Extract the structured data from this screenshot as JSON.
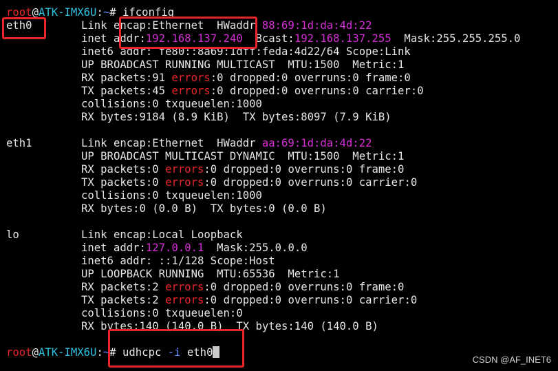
{
  "colors": {
    "background": "#000000",
    "text": "#e6e6e6",
    "user": "#e8262a",
    "host": "#2ec0e0",
    "path": "#5b8cff",
    "address": "#d62ed6",
    "errors": "#e8262a",
    "highlight_box": "#e8262a"
  },
  "prompt": {
    "user": "root",
    "at": "@",
    "host": "ATK-IMX6U",
    "sep": ":",
    "path": "~",
    "sym": "#"
  },
  "cmd1": " ifconfig",
  "eth0": {
    "name": "eth0",
    "l1": {
      "a": "Link encap:Ethernet  HWaddr ",
      "hw": "88:69:1d:da:4d:22"
    },
    "l2": {
      "a": "inet addr:",
      "ip": "192.168.137.240",
      "b": "  Bcast:",
      "bc": "192.168.137.255",
      "c": "  Mask:255.255.255.0"
    },
    "l3": "inet6 addr: fe80::8a69:1dff:feda:4d22/64 Scope:Link",
    "l4": "UP BROADCAST RUNNING MULTICAST  MTU:1500  Metric:1",
    "l5": {
      "a": "RX packets:91 ",
      "e": "errors",
      "b": ":0 dropped:0 overruns:0 frame:0"
    },
    "l6": {
      "a": "TX packets:45 ",
      "e": "errors",
      "b": ":0 dropped:0 overruns:0 carrier:0"
    },
    "l7": "collisions:0 txqueuelen:1000",
    "l8": "RX bytes:9184 (8.9 KiB)  TX bytes:8097 (7.9 KiB)"
  },
  "eth1": {
    "name": "eth1",
    "l1": {
      "a": "Link encap:Ethernet  HWaddr ",
      "hw": "aa:69:1d:da:4d:22"
    },
    "l2": "UP BROADCAST MULTICAST DYNAMIC  MTU:1500  Metric:1",
    "l3": {
      "a": "RX packets:0 ",
      "e": "errors",
      "b": ":0 dropped:0 overruns:0 frame:0"
    },
    "l4": {
      "a": "TX packets:0 ",
      "e": "errors",
      "b": ":0 dropped:0 overruns:0 carrier:0"
    },
    "l5": "collisions:0 txqueuelen:1000",
    "l6": "RX bytes:0 (0.0 B)  TX bytes:0 (0.0 B)"
  },
  "lo": {
    "name": "lo",
    "l1": "Link encap:Local Loopback",
    "l2": {
      "a": "inet addr:",
      "ip": "127.0.0.1",
      "b": "  Mask:255.0.0.0"
    },
    "l3": "inet6 addr: ::1/128 Scope:Host",
    "l4": "UP LOOPBACK RUNNING  MTU:65536  Metric:1",
    "l5": {
      "a": "RX packets:2 ",
      "e": "errors",
      "b": ":0 dropped:0 overruns:0 frame:0"
    },
    "l6": {
      "a": "TX packets:2 ",
      "e": "errors",
      "b": ":0 dropped:0 overruns:0 carrier:0"
    },
    "l7": "collisions:0 txqueuelen:0",
    "l8": "RX bytes:140 (140.0 B)  TX bytes:140 (140.0 B)"
  },
  "cmd2": {
    "a": " udhcpc ",
    "opt": "-i",
    "b": " eth0"
  },
  "watermark": "CSDN @AF_INET6"
}
